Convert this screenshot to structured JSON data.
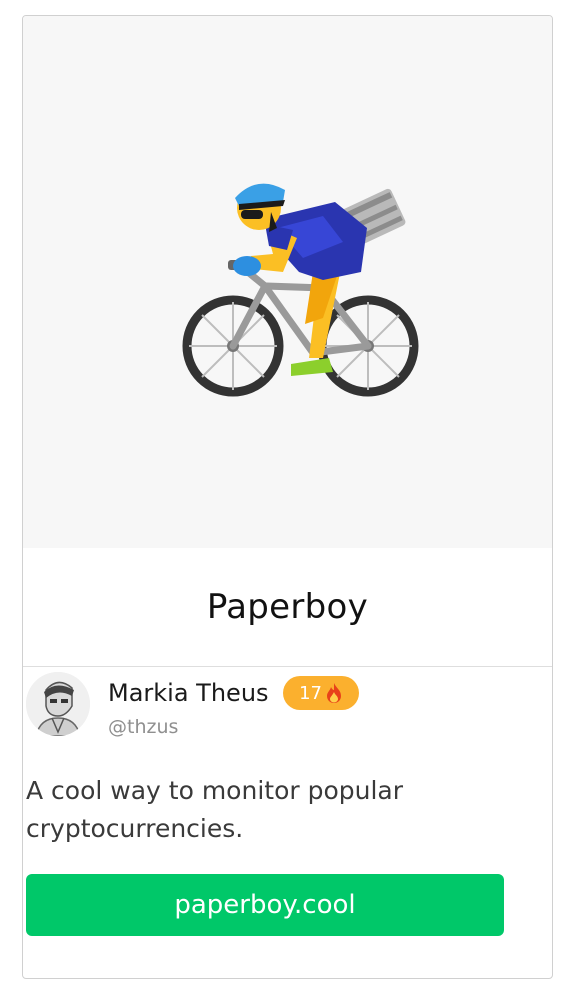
{
  "product": {
    "title": "Paperboy",
    "hero_icon": "person-biking-emoji",
    "description": "A cool way to monitor popular cryptocurrencies.",
    "link_label": "paperboy.cool"
  },
  "maker": {
    "name": "Markia Theus",
    "handle": "@thzus",
    "badge_count": "17",
    "badge_icon": "fire-icon",
    "avatar_icon": "avatar-portrait"
  },
  "colors": {
    "cta": "#00c869",
    "badge": "#fbb02e",
    "hero_bg": "#f7f7f7"
  }
}
